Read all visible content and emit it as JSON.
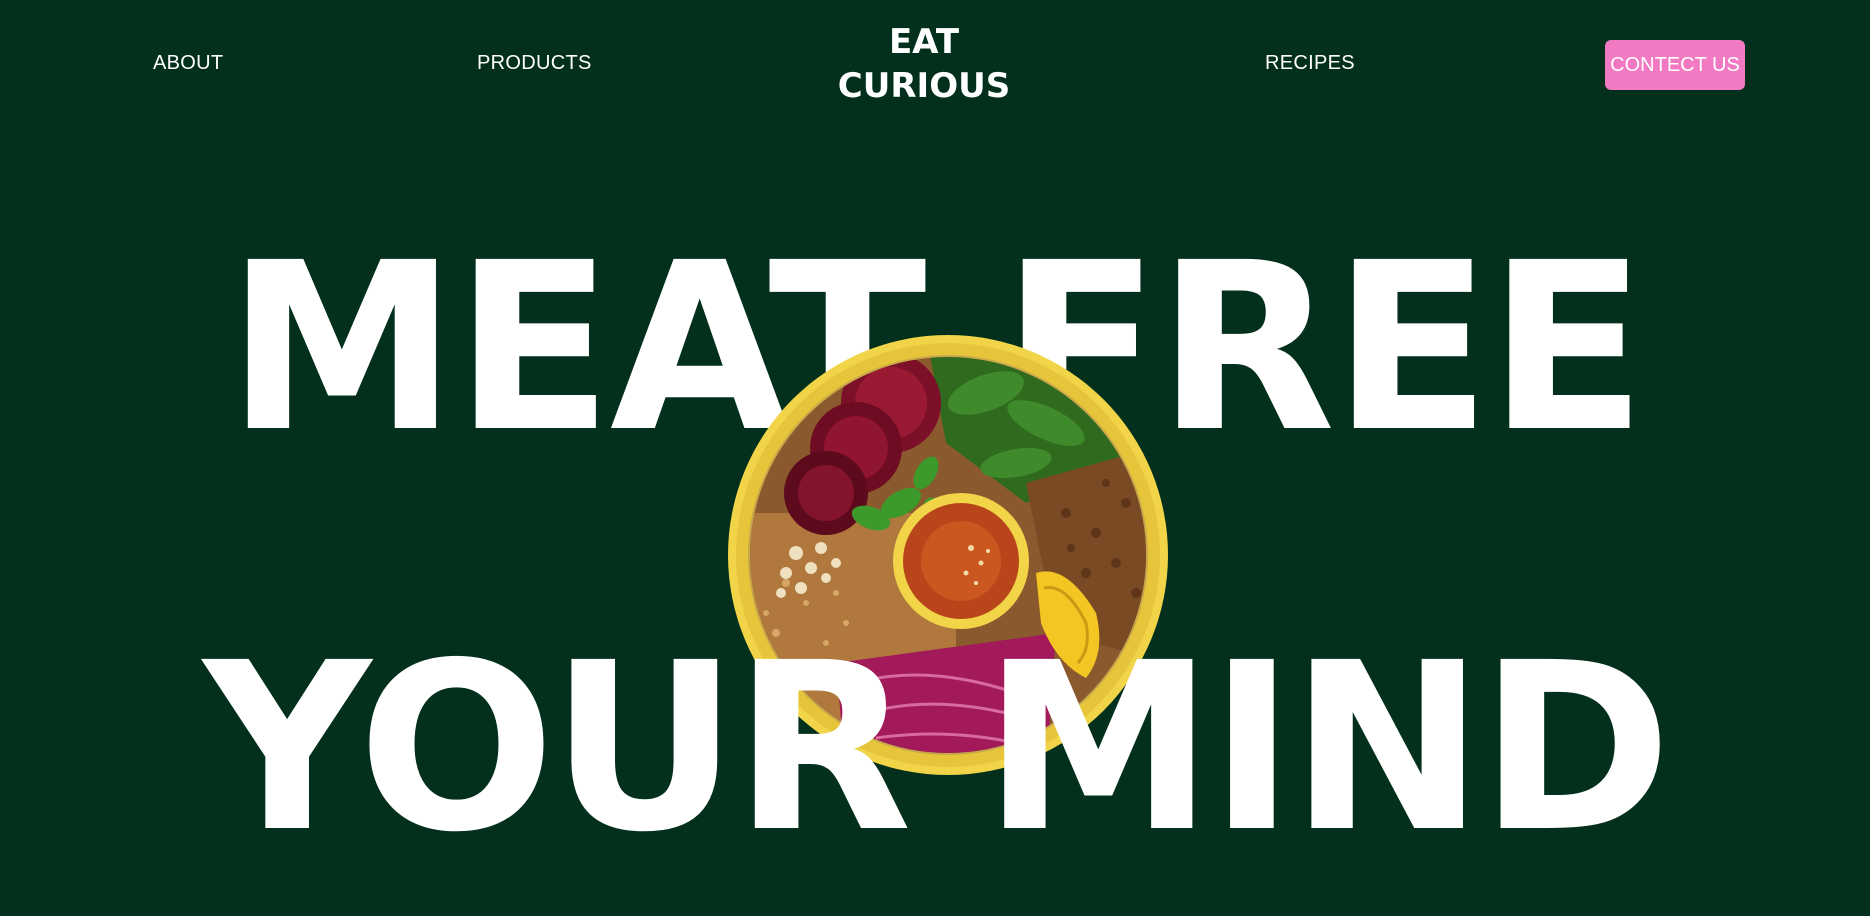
{
  "nav": {
    "about": "ABOUT",
    "products": "PRODUCTS",
    "recipes": "RECIPES",
    "contact_label": "CONTECT US"
  },
  "logo": {
    "line1": "EAT",
    "line2": "CURIOUS"
  },
  "hero": {
    "line1": "MEAT FREE",
    "line2": "YOUR MIND",
    "image": "food-bowl-illustration"
  },
  "colors": {
    "background": "#03301d",
    "text": "#ffffff",
    "accent": "#f17ac3",
    "bowl": "#f1d448"
  }
}
